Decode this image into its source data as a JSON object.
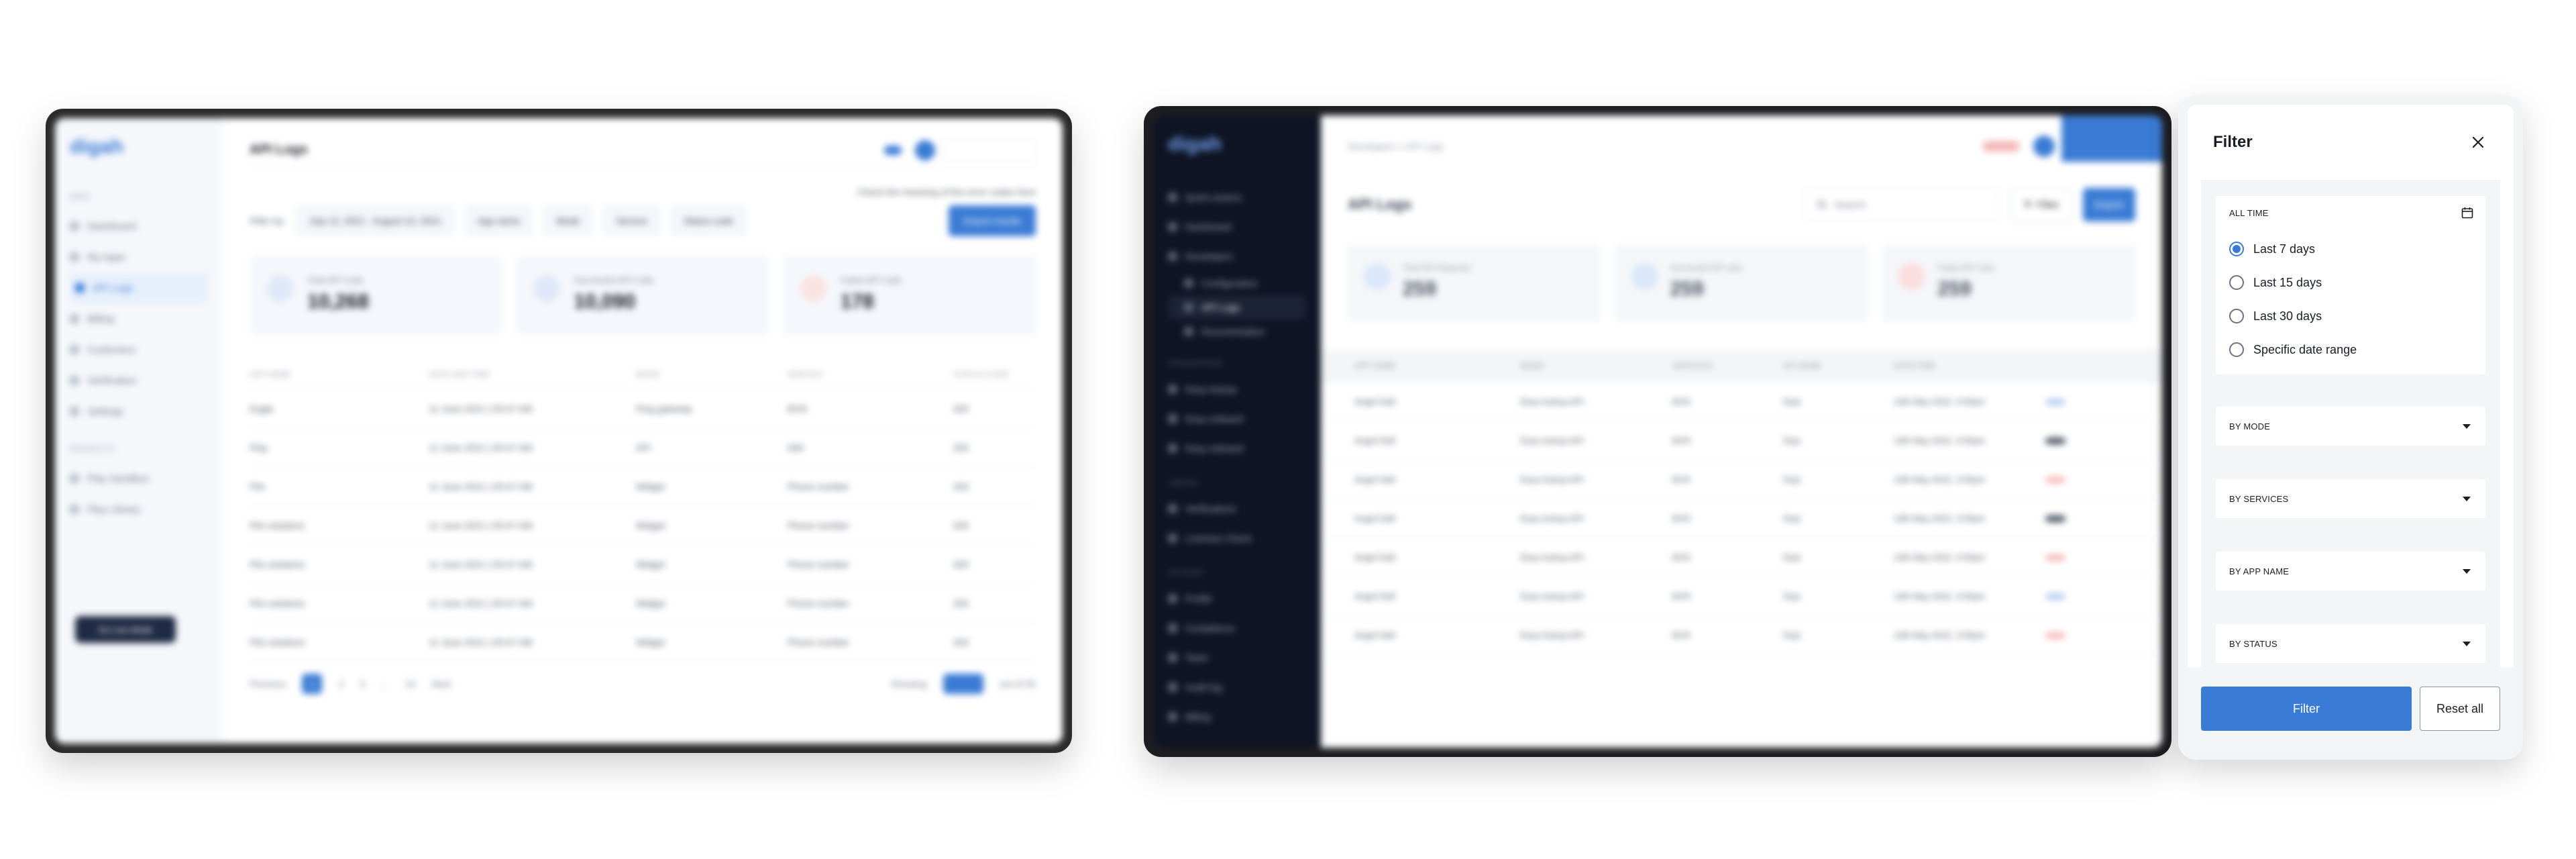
{
  "screen1": {
    "logo": "digah",
    "page_title": "API Logs",
    "note": "Check the meaning of the error codes here",
    "filter_label": "Filter by:",
    "date_range": "July 12, 2021 - August 10, 2021",
    "filters": [
      "App name",
      "Mode",
      "Service",
      "Status code"
    ],
    "export_label": "Export results",
    "nav": [
      "Dashboard",
      "My Apps",
      "API Logs",
      "Billing",
      "Customers",
      "Verification",
      "Settings"
    ],
    "nav_active_index": 2,
    "nav2": [
      "Play Sandbox",
      "Play Library"
    ],
    "cta_label": "Go Live Mode",
    "stats": [
      {
        "label": "Total API Calls",
        "value": "10,268"
      },
      {
        "label": "Successful API Calls",
        "value": "10,090"
      },
      {
        "label": "Failed API Calls",
        "value": "178"
      }
    ],
    "columns": [
      "APP NAME",
      "DATE AND TIME",
      "MODE",
      "SERVICE",
      "STATUS CODE"
    ],
    "rows": [
      {
        "app": "Eagle",
        "date": "11 June 2021 | 05:47 AM",
        "mode": "Ping gateway",
        "service": "BVN",
        "status": "200"
      },
      {
        "app": "Play",
        "date": "11 June 2021 | 05:47 AM",
        "mode": "API",
        "service": "NIN",
        "status": "200"
      },
      {
        "app": "Pilo",
        "date": "11 June 2021 | 05:47 AM",
        "mode": "Widget",
        "service": "Phone number",
        "status": "200"
      },
      {
        "app": "Pilo solutions",
        "date": "11 June 2021 | 05:47 AM",
        "mode": "Widget",
        "service": "Phone number",
        "status": "200"
      },
      {
        "app": "Pilo solutions",
        "date": "11 June 2021 | 05:47 AM",
        "mode": "Widget",
        "service": "Phone number",
        "status": "200"
      },
      {
        "app": "Pilo solutions",
        "date": "11 June 2021 | 05:47 AM",
        "mode": "Widget",
        "service": "Phone number",
        "status": "200"
      },
      {
        "app": "Pilo solutions",
        "date": "11 June 2021 | 05:47 AM",
        "mode": "Widget",
        "service": "Phone number",
        "status": "200"
      }
    ],
    "pager": {
      "prev": "Previous",
      "pages": [
        "1",
        "2",
        "3",
        "...",
        "10"
      ],
      "next": "Next",
      "showing": "Showing",
      "of": "out of 50"
    }
  },
  "screen2": {
    "logo": "digah",
    "breadcrumb": "Developers > API Logs",
    "page_title": "API Logs",
    "search_placeholder": "Search",
    "filter_label": "Filter",
    "export_label": "Export",
    "nav": [
      "Quick actions",
      "Dashboard",
      "Developers",
      "Configuration",
      "API Logs",
      "Documentation"
    ],
    "nav_group2": "INTEGRATIONS",
    "nav2": [
      "Easy lookup",
      "Easy onboard",
      "Easy onboard"
    ],
    "nav_group3": "CHECKS",
    "nav3": [
      "Verifications",
      "Liveness Check"
    ],
    "nav_group4": "ACCOUNT",
    "nav4": [
      "Profile",
      "Compliance",
      "Team",
      "Audit log",
      "Billing"
    ],
    "stats": [
      {
        "label": "Total API Requests",
        "value": "259"
      },
      {
        "label": "Successful API calls",
        "value": "259"
      },
      {
        "label": "Failed API Calls",
        "value": "259"
      }
    ],
    "columns": [
      "APP NAME",
      "MODE",
      "SERVICES",
      "API NAME",
      "DATE/TIME",
      ""
    ],
    "rows": [
      {
        "app": "Angel Daft",
        "mode": "Easy lookup API",
        "service": "BVN",
        "api": "Dojo",
        "date": "13th May 2022, 3:05pm",
        "status": "blue"
      },
      {
        "app": "Angel Daft",
        "mode": "Easy lookup API",
        "service": "BVN",
        "api": "Dojo",
        "date": "13th May 2022, 3:05pm",
        "status": "dark"
      },
      {
        "app": "Angel Daft",
        "mode": "Easy lookup API",
        "service": "BVN",
        "api": "Dojo",
        "date": "13th May 2022, 3:05pm",
        "status": "red"
      },
      {
        "app": "Angel Daft",
        "mode": "Easy lookup API",
        "service": "BVN",
        "api": "Dojo",
        "date": "13th May 2022, 3:05pm",
        "status": "dark"
      },
      {
        "app": "Angel Daft",
        "mode": "Easy lookup API",
        "service": "BVN",
        "api": "Dojo",
        "date": "13th May 2022, 3:05pm",
        "status": "red"
      },
      {
        "app": "Angel Daft",
        "mode": "Easy lookup API",
        "service": "BVN",
        "api": "Dojo",
        "date": "13th May 2022, 3:05pm",
        "status": "blue"
      },
      {
        "app": "Angel Daft",
        "mode": "Easy lookup API",
        "service": "BVN",
        "api": "Dojo",
        "date": "13th May 2022, 3:05pm",
        "status": "red"
      }
    ]
  },
  "filter_panel": {
    "title": "Filter",
    "all_time_label": "ALL TIME",
    "options": [
      {
        "label": "Last 7 days",
        "checked": true
      },
      {
        "label": "Last 15 days",
        "checked": false
      },
      {
        "label": "Last 30 days",
        "checked": false
      },
      {
        "label": "Specific date range",
        "checked": false
      }
    ],
    "dropdowns": [
      "BY MODE",
      "BY SERVICES",
      "BY APP NAME",
      "BY STATUS"
    ],
    "filter_button": "Filter",
    "reset_button": "Reset all"
  },
  "colors": {
    "accent": "#3a7bd5",
    "dark_sidebar": "#0f1424",
    "text": "#1a1d26"
  }
}
